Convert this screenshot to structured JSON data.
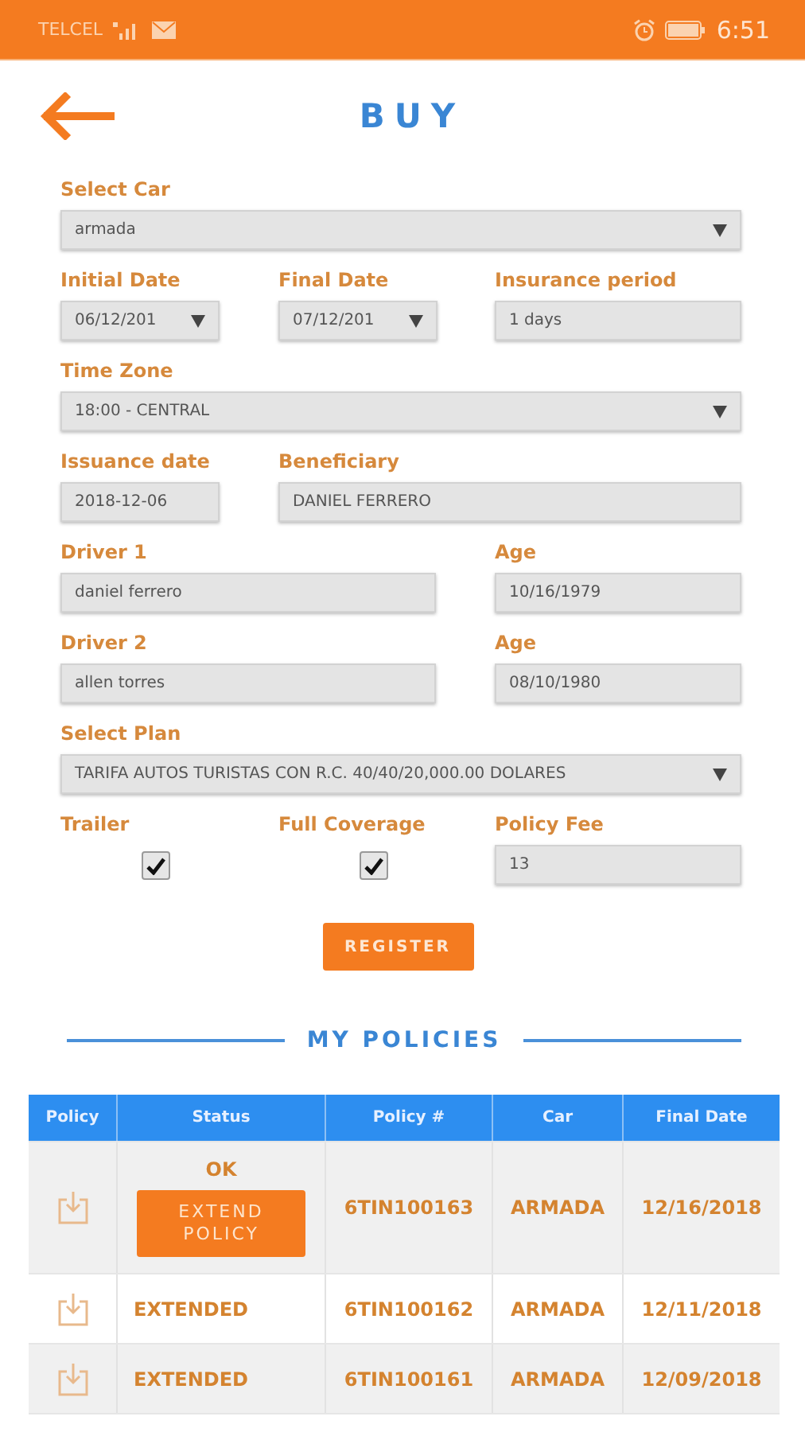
{
  "status_bar": {
    "carrier": "TELCEL",
    "time": "6:51"
  },
  "header": {
    "title": "BUY"
  },
  "form": {
    "rows": [
      {
        "fields": [
          {
            "label": "Select Car",
            "kind": "select",
            "value": "armada"
          }
        ]
      },
      {
        "fields": [
          {
            "label": "Initial Date",
            "kind": "select",
            "value": "06/12/201"
          },
          {
            "label": "Final Date",
            "kind": "select",
            "value": "07/12/201"
          },
          {
            "label": "Insurance period",
            "kind": "text",
            "value": "1 days"
          }
        ]
      },
      {
        "fields": [
          {
            "label": "Time Zone",
            "kind": "select",
            "value": "18:00 - CENTRAL"
          }
        ]
      },
      {
        "fields": [
          {
            "label": "Issuance date",
            "kind": "text",
            "value": "2018-12-06"
          },
          {
            "label": "Beneficiary",
            "kind": "text",
            "value": "DANIEL FERRERO"
          }
        ]
      },
      {
        "fields": [
          {
            "label": "Driver 1",
            "kind": "text",
            "value": "daniel ferrero"
          },
          {
            "label": "Age",
            "kind": "text",
            "value": "10/16/1979"
          }
        ]
      },
      {
        "fields": [
          {
            "label": "Driver 2",
            "kind": "text",
            "value": "allen torres"
          },
          {
            "label": "Age",
            "kind": "text",
            "value": "08/10/1980"
          }
        ]
      },
      {
        "fields": [
          {
            "label": "Select Plan",
            "kind": "select",
            "value": "TARIFA AUTOS TURISTAS CON R.C. 40/40/20,000.00 DOLARES"
          }
        ]
      },
      {
        "fields": [
          {
            "label": "Trailer",
            "kind": "checkbox",
            "checked": true
          },
          {
            "label": "Full Coverage",
            "kind": "checkbox",
            "checked": true
          },
          {
            "label": "Policy Fee",
            "kind": "text",
            "value": "13"
          }
        ]
      }
    ],
    "submit": "REGISTER"
  },
  "policies": {
    "title": "MY POLICIES",
    "columns": [
      "Policy",
      "Status",
      "Policy #",
      "Car",
      "Final Date"
    ],
    "rows": [
      {
        "status": "OK",
        "action": "EXTEND POLICY",
        "policy": "6TIN100163",
        "car": "ARMADA",
        "final_date": "12/16/2018"
      },
      {
        "status": "EXTENDED",
        "policy": "6TIN100162",
        "car": "ARMADA",
        "final_date": "12/11/2018"
      },
      {
        "status": "EXTENDED",
        "policy": "6TIN100161",
        "car": "ARMADA",
        "final_date": "12/09/2018"
      }
    ]
  }
}
